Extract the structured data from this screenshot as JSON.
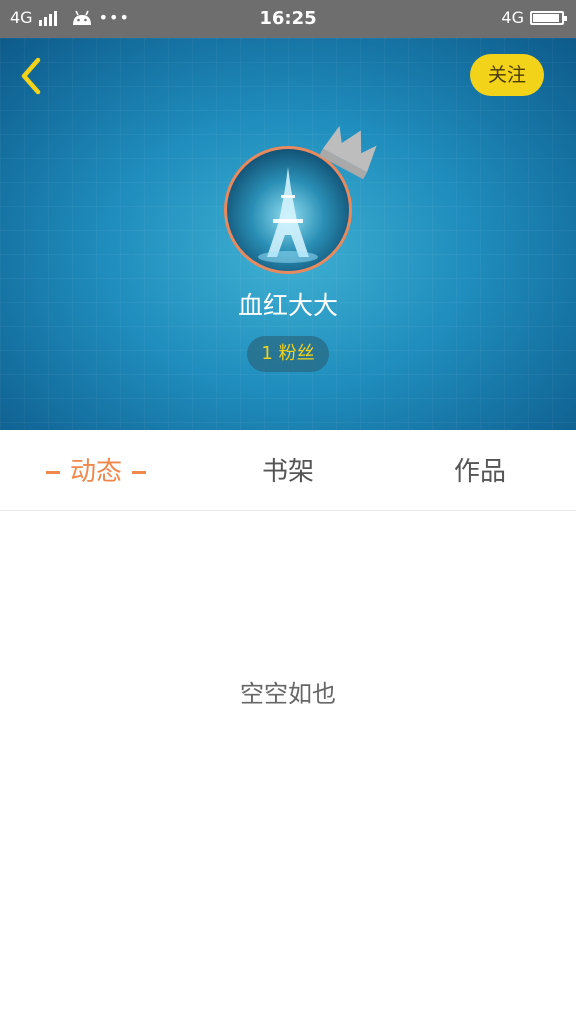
{
  "status_bar": {
    "network_left": "4G",
    "dots": "•••",
    "time": "16:25",
    "network_right": "4G",
    "battery_level": 0.92,
    "icons": [
      "signal-icon",
      "android-icon",
      "battery-icon"
    ]
  },
  "header": {
    "follow_label": "关注",
    "username": "血红大大",
    "fans": "1 粉丝",
    "icons": [
      "back-arrow-icon",
      "crown-icon",
      "avatar"
    ]
  },
  "tabs": [
    {
      "label": "动态",
      "active": true
    },
    {
      "label": "书架",
      "active": false
    },
    {
      "label": "作品",
      "active": false
    }
  ],
  "content": {
    "empty_message": "空空如也"
  },
  "colors": {
    "accent": "#f0884e",
    "follow_button": "#f2d31a",
    "header_blue": "#1f8dbd",
    "status_bar": "#6e6e6e"
  }
}
